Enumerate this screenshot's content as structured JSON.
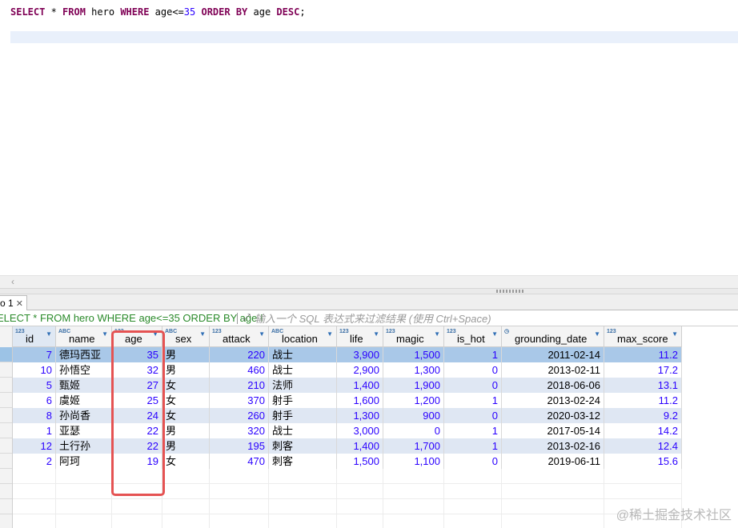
{
  "editor": {
    "sql_tokens": [
      {
        "t": "SELECT",
        "k": "kw"
      },
      {
        "t": " * ",
        "k": "plain"
      },
      {
        "t": "FROM",
        "k": "kw"
      },
      {
        "t": " hero ",
        "k": "plain"
      },
      {
        "t": "WHERE",
        "k": "kw"
      },
      {
        "t": " age<=",
        "k": "plain"
      },
      {
        "t": "35",
        "k": "num"
      },
      {
        "t": " ",
        "k": "plain"
      },
      {
        "t": "ORDER BY",
        "k": "kw"
      },
      {
        "t": " age ",
        "k": "plain"
      },
      {
        "t": "DESC",
        "k": "kw"
      },
      {
        "t": ";",
        "k": "plain"
      }
    ]
  },
  "result_tab": {
    "label": "o 1",
    "close_glyph": "✕"
  },
  "filter": {
    "query_text": "ELECT * FROM hero WHERE age<=35 ORDER BY age I",
    "placeholder": "输入一个 SQL 表达式来过滤结果 (使用 Ctrl+Space)",
    "icon": "expand-filter-icon"
  },
  "grid": {
    "columns": [
      {
        "name": "id",
        "type_badge": "123",
        "align": "num",
        "width": 54
      },
      {
        "name": "name",
        "type_badge": "ABC",
        "align": "txt",
        "width": 70
      },
      {
        "name": "age",
        "type_badge": "123",
        "align": "num",
        "width": 63
      },
      {
        "name": "sex",
        "type_badge": "ABC",
        "align": "txt",
        "width": 59
      },
      {
        "name": "attack",
        "type_badge": "123",
        "align": "num",
        "width": 74
      },
      {
        "name": "location",
        "type_badge": "ABC",
        "align": "txt",
        "width": 85
      },
      {
        "name": "life",
        "type_badge": "123",
        "align": "num",
        "width": 58
      },
      {
        "name": "magic",
        "type_badge": "123",
        "align": "num",
        "width": 76
      },
      {
        "name": "is_hot",
        "type_badge": "123",
        "align": "num",
        "width": 72
      },
      {
        "name": "grounding_date",
        "type_badge": "◷",
        "align": "date",
        "width": 128
      },
      {
        "name": "max_score",
        "type_badge": "123",
        "align": "num",
        "width": 97
      }
    ],
    "rows": [
      [
        "7",
        "德玛西亚",
        "35",
        "男",
        "220",
        "战士",
        "3,900",
        "1,500",
        "1",
        "2011-02-14",
        "11.2"
      ],
      [
        "10",
        "孙悟空",
        "32",
        "男",
        "460",
        "战士",
        "2,900",
        "1,300",
        "0",
        "2013-02-11",
        "17.2"
      ],
      [
        "5",
        "甄姬",
        "27",
        "女",
        "210",
        "法师",
        "1,400",
        "1,900",
        "0",
        "2018-06-06",
        "13.1"
      ],
      [
        "6",
        "虞姬",
        "25",
        "女",
        "370",
        "射手",
        "1,600",
        "1,200",
        "1",
        "2013-02-24",
        "11.2"
      ],
      [
        "8",
        "孙尚香",
        "24",
        "女",
        "260",
        "射手",
        "1,300",
        "900",
        "0",
        "2020-03-12",
        "9.2"
      ],
      [
        "1",
        "亚瑟",
        "22",
        "男",
        "320",
        "战士",
        "3,000",
        "0",
        "1",
        "2017-05-14",
        "14.2"
      ],
      [
        "12",
        "土行孙",
        "22",
        "男",
        "195",
        "刺客",
        "1,400",
        "1,700",
        "1",
        "2013-02-16",
        "12.4"
      ],
      [
        "2",
        "阿珂",
        "19",
        "女",
        "470",
        "刺客",
        "1,500",
        "1,100",
        "0",
        "2019-06-11",
        "15.6"
      ]
    ],
    "selected_row": 0
  },
  "watermark_text": "@稀土掘金技术社区",
  "colors": {
    "keyword": "#7f0055",
    "number": "#2a00ff",
    "filter_query": "#2a8a2a",
    "selected_row": "#a9c8e8",
    "striped_row": "#dfe7f3",
    "highlight_box": "#e55353"
  }
}
